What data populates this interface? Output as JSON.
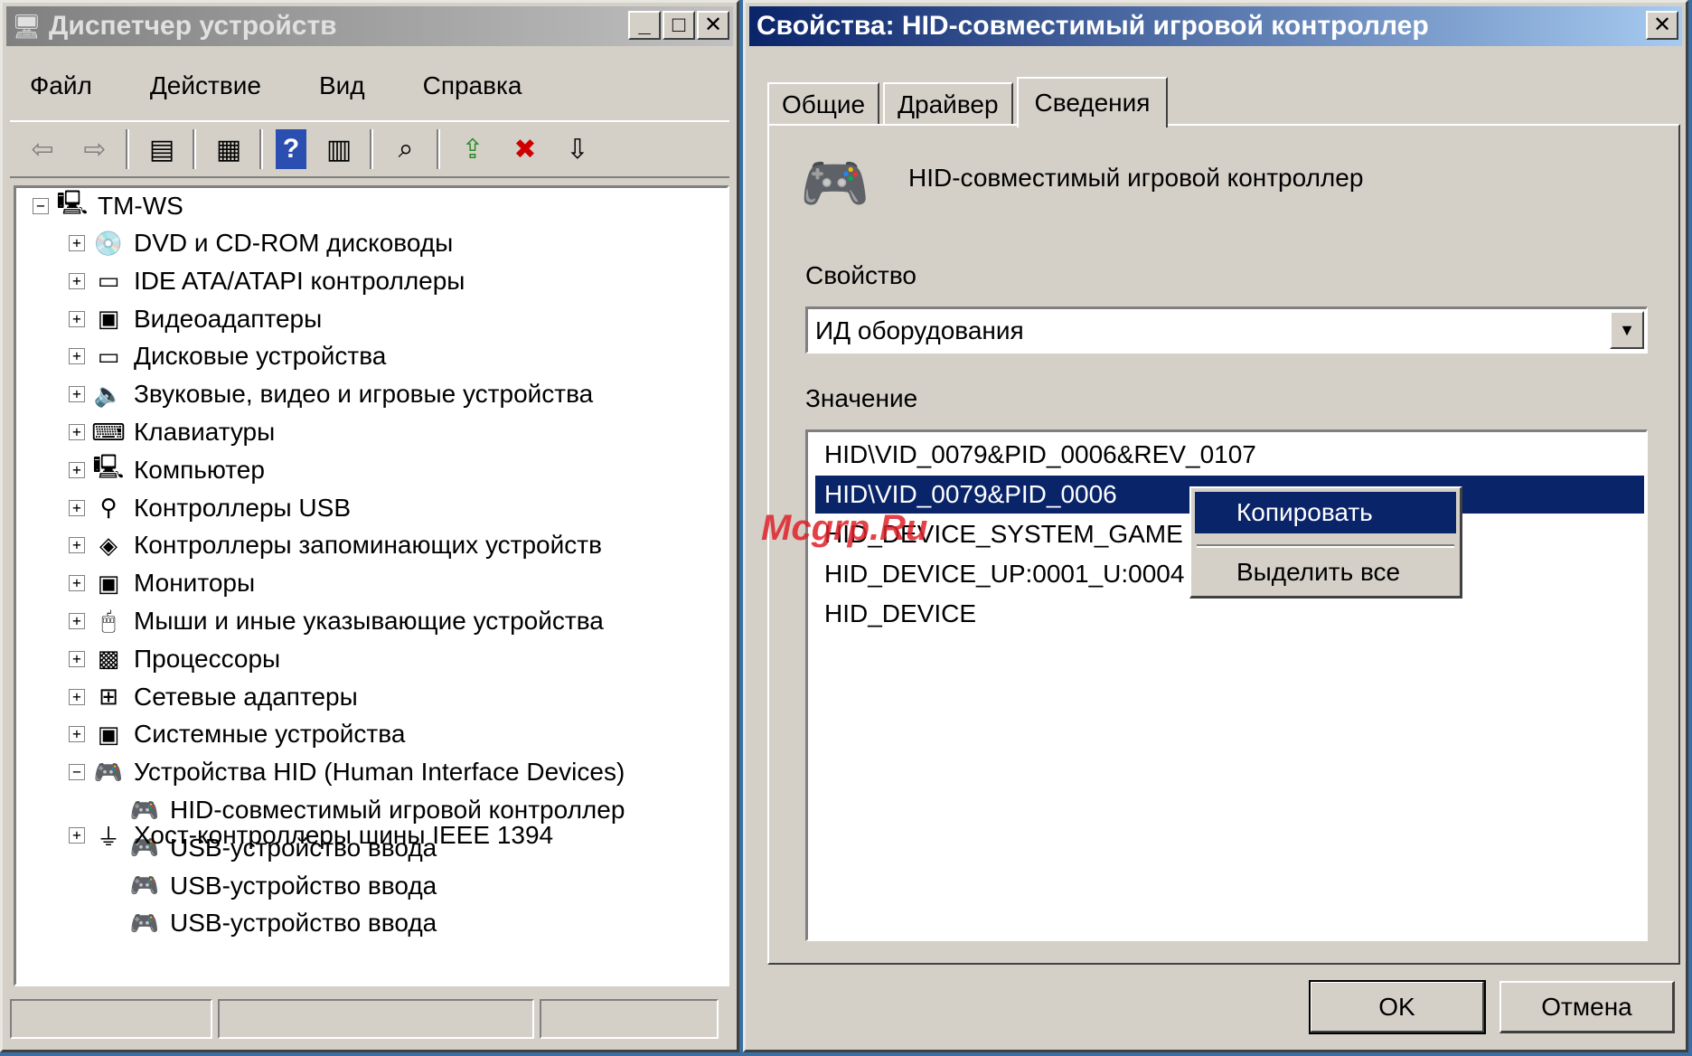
{
  "devmgr": {
    "title": "Диспетчер устройств",
    "buttons": {
      "minimize": "_",
      "maximize": "□",
      "close": "✕"
    },
    "menu": [
      "Файл",
      "Действие",
      "Вид",
      "Справка"
    ],
    "tree": {
      "root": "TM-WS",
      "categories": [
        {
          "label": "DVD и CD-ROM дисководы",
          "icon": "cdrom-icon"
        },
        {
          "label": "IDE ATA/ATAPI контроллеры",
          "icon": "ide-icon"
        },
        {
          "label": "Видеоадаптеры",
          "icon": "display-adapter-icon"
        },
        {
          "label": "Дисковые устройства",
          "icon": "disk-icon"
        },
        {
          "label": "Звуковые, видео и игровые устройства",
          "icon": "speaker-icon"
        },
        {
          "label": "Клавиатуры",
          "icon": "keyboard-icon"
        },
        {
          "label": "Компьютер",
          "icon": "computer-icon"
        },
        {
          "label": "Контроллеры USB",
          "icon": "usb-icon"
        },
        {
          "label": "Контроллеры запоминающих устройств",
          "icon": "storage-icon"
        },
        {
          "label": "Мониторы",
          "icon": "monitor-icon"
        },
        {
          "label": "Мыши и иные указывающие устройства",
          "icon": "mouse-icon"
        },
        {
          "label": "Процессоры",
          "icon": "cpu-icon"
        },
        {
          "label": "Сетевые адаптеры",
          "icon": "network-icon"
        },
        {
          "label": "Системные устройства",
          "icon": "system-icon"
        },
        {
          "label": "Устройства HID (Human Interface Devices)",
          "icon": "hid-icon"
        }
      ],
      "hid_children": [
        "HID-совместимый игровой контроллер",
        "USB-устройство ввода",
        "USB-устройство ввода",
        "USB-устройство ввода"
      ],
      "last": "Хост-контроллеры шины IEEE 1394"
    }
  },
  "props": {
    "title": "Свойства: HID-совместимый игровой контроллер",
    "close": "✕",
    "tabs": [
      "Общие",
      "Драйвер",
      "Сведения"
    ],
    "active_tab": "Сведения",
    "device_name": "HID-совместимый игровой контроллер",
    "property_label": "Свойство",
    "property_value": "ИД оборудования",
    "value_label": "Значение",
    "values": [
      "HID\\VID_0079&PID_0006&REV_0107",
      "HID\\VID_0079&PID_0006",
      "HID_DEVICE_SYSTEM_GAME",
      "HID_DEVICE_UP:0001_U:0004",
      "HID_DEVICE"
    ],
    "selected_index": 1,
    "context_menu": [
      "Копировать",
      "Выделить все"
    ],
    "ok": "OK",
    "cancel": "Отмена"
  },
  "watermark": "Mcgrp.Ru"
}
